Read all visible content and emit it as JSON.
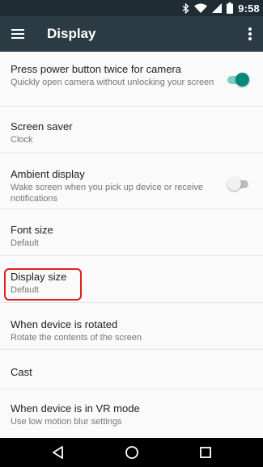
{
  "status_bar": {
    "time": "9:58",
    "icons": [
      "bluetooth-icon",
      "wifi-icon",
      "cell-signal-icon",
      "battery-icon"
    ]
  },
  "app_bar": {
    "title": "Display",
    "menu_icon": "hamburger-menu-icon",
    "overflow_icon": "more-vert-icon"
  },
  "settings": [
    {
      "title": "Press power button twice for camera",
      "summary": "Quickly open camera without unlocking your screen",
      "toggle": "on"
    },
    {
      "title": "Screen saver",
      "summary": "Clock"
    },
    {
      "title": "Ambient display",
      "summary": "Wake screen when you pick up device or receive notifications",
      "toggle": "off"
    },
    {
      "title": "Font size",
      "summary": "Default"
    },
    {
      "title": "Display size",
      "summary": "Default",
      "highlighted": true
    },
    {
      "title": "When device is rotated",
      "summary": "Rotate the contents of the screen"
    },
    {
      "title": "Cast",
      "summary": ""
    },
    {
      "title": "When device is in VR mode",
      "summary": "Use low motion blur settings"
    }
  ],
  "nav_bar": {
    "buttons": [
      "back-icon",
      "home-icon",
      "recents-icon"
    ]
  },
  "colors": {
    "status_bar": "#1f2c33",
    "app_bar": "#2b3b44",
    "accent": "#00897b",
    "highlight_box": "#e02020"
  }
}
